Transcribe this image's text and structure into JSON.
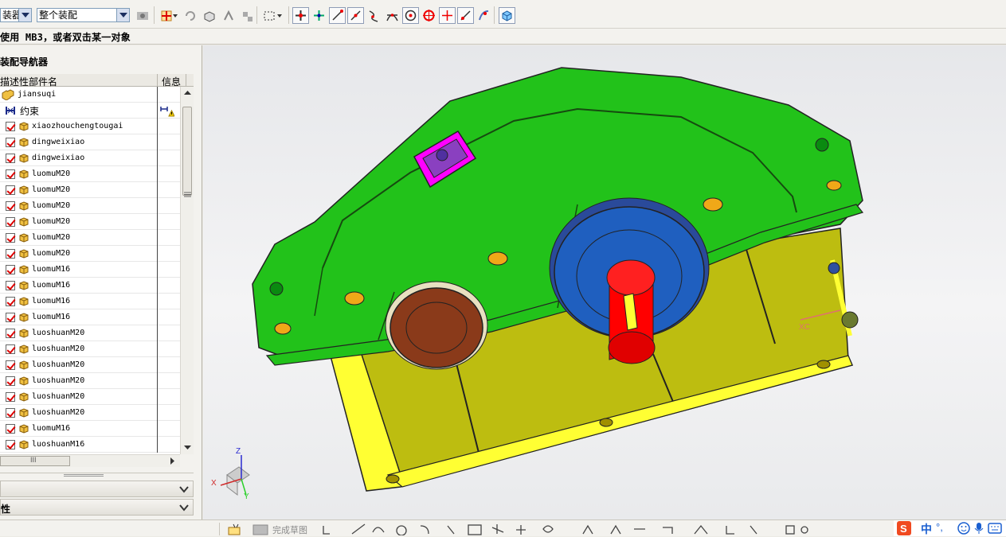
{
  "toolbar": {
    "filter_dropdown": "装器",
    "scope_dropdown": "整个装配"
  },
  "status": {
    "prompt": "使用 MB3，或者双击某一对象"
  },
  "navigator": {
    "title": "装配导航器",
    "columns": {
      "name": "描述性部件名",
      "info": "信息"
    },
    "root": "jiansuqi",
    "constraints": "约束",
    "parts": [
      "xiaozhouchengtougai",
      "dingweixiao",
      "dingweixiao",
      "luomuM20",
      "luomuM20",
      "luomuM20",
      "luomuM20",
      "luomuM20",
      "luomuM20",
      "luomuM16",
      "luomuM16",
      "luomuM16",
      "luomuM16",
      "luoshuanM20",
      "luoshuanM20",
      "luoshuanM20",
      "luoshuanM20",
      "luoshuanM20",
      "luoshuanM20",
      "luomuM16",
      "luoshuanM16"
    ],
    "hscroll_grip": "III",
    "panel2_label": "",
    "panel3_label": "性"
  },
  "viewport": {
    "triad": {
      "x": "X",
      "y": "Y",
      "z": "Z",
      "wcs": "XC"
    }
  },
  "bottombar": {
    "finish_sketch": "完成草图"
  },
  "ime": {
    "lang": "中"
  },
  "colors": {
    "upper_housing": "#22c21a",
    "lower_housing": "#bdbd10",
    "flange": "#ffff33",
    "bearing_cap_large": "#1f5fbf",
    "bearing_cap_small": "#8a3a1a",
    "shaft": "#ff0000",
    "inspection_cover": "#ff00ff",
    "bolt": "#e8a010"
  }
}
